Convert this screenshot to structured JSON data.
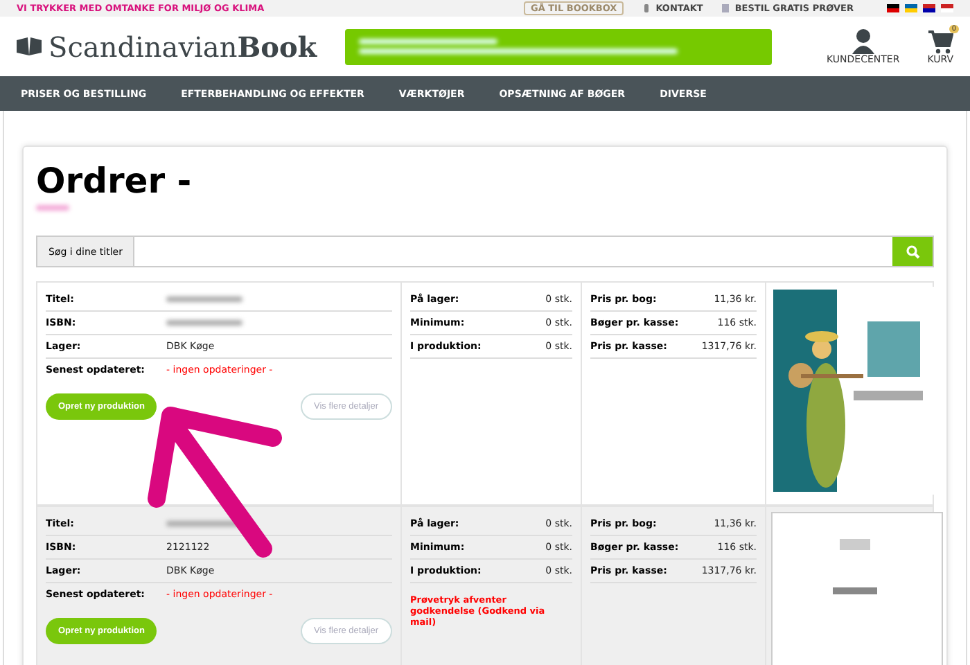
{
  "top_bar": {
    "slogan": "VI TRYKKER MED OMTANKE FOR MILJØ OG KLIMA",
    "links": [
      {
        "label": "GÅ TIL BOOKBOX",
        "kind": "boxed"
      },
      {
        "label": "KONTAKT",
        "kind": "phone"
      },
      {
        "label": "BESTIL GRATIS PRØVER",
        "kind": "doc"
      }
    ],
    "flags": [
      {
        "kind": "de"
      },
      {
        "kind": "se"
      },
      {
        "kind": "no"
      },
      {
        "kind": "dk"
      }
    ]
  },
  "header": {
    "logo_light": "Scandinavian",
    "logo_bold": "Book",
    "account": "KUNDECENTER",
    "cart": "KURV",
    "cart_count": "0"
  },
  "nav": [
    "PRISER OG BESTILLING",
    "EFTERBEHANDLING OG EFFEKTER",
    "VÆRKTØJER",
    "OPSÆTNING AF BØGER",
    "DIVERSE"
  ],
  "page": {
    "title": "Ordrer -"
  },
  "search": {
    "label": "Søg i dine titler"
  },
  "orders": [
    {
      "shaded": false,
      "fields": [
        {
          "label": "Titel:"
        },
        {
          "label": "ISBN:"
        },
        {
          "label": "Lager:",
          "value": "DBK Køge"
        },
        {
          "label": "Senest opdateret:",
          "value": "- ingen opdateringer -",
          "kind": "alert"
        }
      ],
      "stock": [
        {
          "label": "På lager:",
          "value": "0 stk."
        },
        {
          "label": "Minimum:",
          "value": "0 stk."
        },
        {
          "label": "I produktion:",
          "value": "0 stk."
        }
      ],
      "prices": [
        {
          "label": "Pris pr. bog:",
          "value": "11,36 kr."
        },
        {
          "label": "Bøger pr. kasse:",
          "value": "116 stk."
        },
        {
          "label": "Pris pr. kasse:",
          "value": "1317,76 kr."
        }
      ],
      "create": "Opret ny produktion",
      "details": "Vis flere detaljer",
      "cover": {
        "kind": "picture"
      }
    },
    {
      "shaded": true,
      "fields": [
        {
          "label": "Titel:"
        },
        {
          "label": "ISBN:",
          "value": "2121122"
        },
        {
          "label": "Lager:",
          "value": "DBK Køge"
        },
        {
          "label": "Senest opdateret:",
          "value": "- ingen opdateringer -",
          "kind": "alert"
        }
      ],
      "stock": [
        {
          "label": "På lager:",
          "value": "0 stk."
        },
        {
          "label": "Minimum:",
          "value": "0 stk."
        },
        {
          "label": "I produktion:",
          "value": "0 stk."
        }
      ],
      "notice": "Prøvetryk afventer godkendelse (Godkend via mail)",
      "prices": [
        {
          "label": "Pris pr. bog:",
          "value": "11,36 kr."
        },
        {
          "label": "Bøger pr. kasse:",
          "value": "116 stk."
        },
        {
          "label": "Pris pr. kasse:",
          "value": "1317,76 kr."
        }
      ],
      "create": "Opret ny produktion",
      "details": "Vis flere detaljer",
      "cover": {
        "kind": "picture"
      }
    }
  ]
}
